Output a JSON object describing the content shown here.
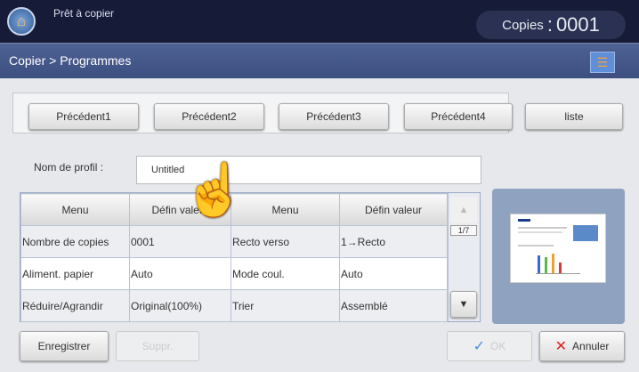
{
  "header": {
    "status": "Prêt à copier",
    "copies_label": "Copies",
    "copies_value": "0001"
  },
  "breadcrumb": "Copier > Programmes",
  "presets": [
    "Précédent1",
    "Précédent2",
    "Précédent3",
    "Précédent4"
  ],
  "list_button": "liste",
  "profile": {
    "label": "Nom de profil :",
    "value": "Untitled"
  },
  "table": {
    "headers": [
      "Menu",
      "Défin valeur",
      "Menu",
      "Défin valeur"
    ],
    "rows": [
      [
        "Nombre de copies",
        "0001",
        "Recto verso",
        "1→Recto"
      ],
      [
        "Aliment. papier",
        "Auto",
        "Mode coul.",
        "Auto"
      ],
      [
        "Réduire/Agrandir",
        "Original(100%)",
        "Trier",
        "Assemblé"
      ]
    ],
    "page": "1/7"
  },
  "buttons": {
    "save": "Enregistrer",
    "delete": "Suppr.",
    "ok": "OK",
    "cancel": "Annuler"
  }
}
